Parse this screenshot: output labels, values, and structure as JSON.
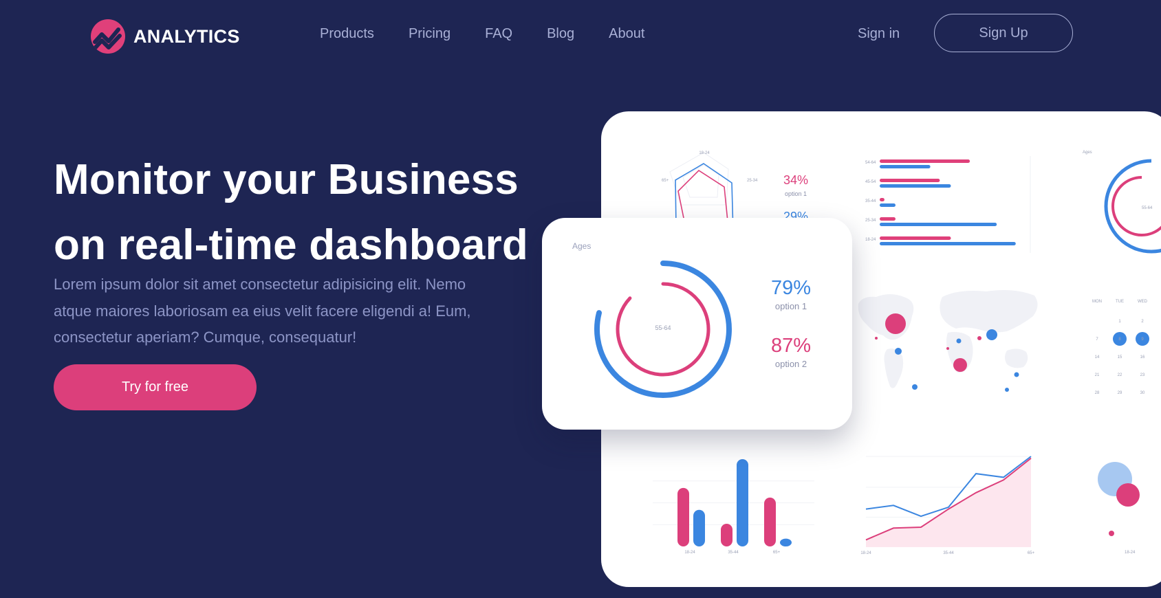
{
  "brand": {
    "name": "ANALYTICS",
    "accent": "#e0407a",
    "background": "#1e2553",
    "secondary": "#3b86e0"
  },
  "nav": {
    "items": [
      "Products",
      "Pricing",
      "FAQ",
      "Blog",
      "About"
    ]
  },
  "auth": {
    "signin_label": "Sign in",
    "signup_label": "Sign Up"
  },
  "hero": {
    "headline_line1": "Monitor your Business",
    "headline_line2": "on real-time dashboard",
    "lede": "Lorem ipsum dolor sit amet consectetur adipisicing elit. Nemo atque maiores laboriosam ea eius velit facere eligendi a! Eum, consectetur aperiam? Cumque, consequatur!",
    "cta_label": "Try for free"
  },
  "ages_card": {
    "title": "Ages",
    "center_label": "55-64",
    "stat1": {
      "value": "79%",
      "label": "option 1",
      "fraction": 0.79
    },
    "stat2": {
      "value": "87%",
      "label": "option 2",
      "fraction": 0.87
    }
  },
  "dashboard_preview": {
    "radar": {
      "labels": {
        "top": "18-24",
        "left": "65+",
        "right": "25-34"
      },
      "stat1": {
        "value": "34%",
        "label": "option 1"
      },
      "stat2_partial": "29%"
    },
    "hbar": {
      "categories": [
        "54-64",
        "45-54",
        "35-44",
        "25-34",
        "18-24"
      ],
      "pink": [
        0.57,
        0.38,
        0.03,
        0.1,
        0.45
      ],
      "blue": [
        0.32,
        0.45,
        0.1,
        0.74,
        0.86
      ]
    },
    "ages_mini": {
      "title": "Ages",
      "center_label": "55-64"
    },
    "calendar": {
      "days": [
        "MON",
        "TUE",
        "WED"
      ],
      "rows": [
        [
          "",
          "1",
          "2"
        ],
        [
          "7",
          "8",
          "9"
        ],
        [
          "14",
          "15",
          "16"
        ],
        [
          "21",
          "22",
          "23"
        ],
        [
          "28",
          "29",
          "30"
        ]
      ],
      "highlighted": [
        "8",
        "9"
      ]
    },
    "vbars": {
      "categories": [
        "18-24",
        "35-44",
        "65+"
      ],
      "series": [
        {
          "values": [
            0.67,
            0.26,
            0.56
          ],
          "color": "#dc3f7b"
        },
        {
          "values": [
            0.42,
            1.0,
            0.09
          ],
          "color": "#3b86e0"
        }
      ]
    },
    "lines": {
      "xlabels": [
        "18-24",
        "35-44",
        "65+"
      ],
      "series": [
        {
          "values": [
            0.08,
            0.21,
            0.22,
            0.42,
            0.6,
            0.74,
            0.98
          ],
          "color": "#dc3f7b"
        },
        {
          "values": [
            0.42,
            0.46,
            0.34,
            0.44,
            0.81,
            0.77,
            1.0
          ],
          "color": "#3b86e0"
        }
      ]
    },
    "bubble_xlabel": "18-24"
  }
}
